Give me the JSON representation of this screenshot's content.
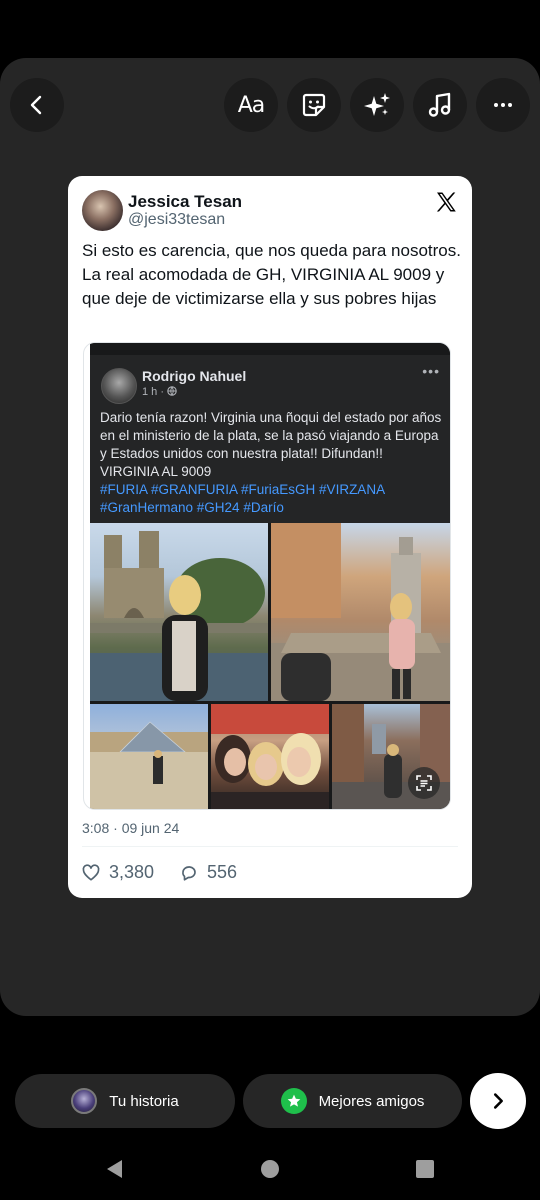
{
  "toolbar": {
    "back": "back-icon",
    "text_label": "Aa",
    "sticker": "sticker-icon",
    "effects": "sparkles-icon",
    "music": "music-icon",
    "more": "more-icon"
  },
  "tweet": {
    "name": "Jessica Tesan",
    "handle": "@jesi33tesan",
    "text": "Si esto es carencia, que nos queda para nosotros. La real acomodada de GH, VIRGINIA AL 9009 y que deje de victimizarse ella y sus pobres hijas",
    "timestamp": "3:08 · 09 jun 24",
    "likes": "3,380",
    "replies": "556"
  },
  "fb_post": {
    "name": "Rodrigo Nahuel",
    "time": "1 h ·",
    "text": "Dario tenía razon! Virginia una ñoqui del estado por años en el ministerio de la plata, se la pasó viajando a Europa y Estados unidos con nuestra plata!! Difundan!! VIRGINIA AL 9009",
    "hashtags": "#FURIA #GRANFURIA #FuriaEsGH #VIRZANA #GranHermano #GH24 #Darío"
  },
  "share": {
    "your_story": "Tu historia",
    "close_friends": "Mejores amigos"
  },
  "colors": {
    "background": "#000000",
    "stage": "#262626",
    "card": "#ffffff",
    "hashtag": "#4599ff",
    "close_friends_badge": "#1fbf4b"
  }
}
